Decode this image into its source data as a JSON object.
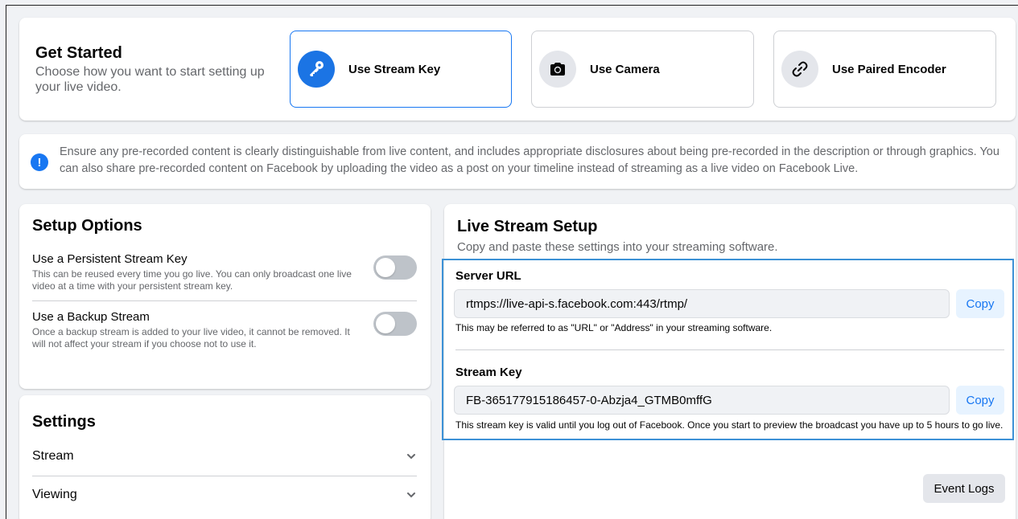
{
  "get_started": {
    "title": "Get Started",
    "subtitle": "Choose how you want to start setting up your live video.",
    "options": [
      {
        "label": "Use Stream Key",
        "icon": "key-icon",
        "selected": true
      },
      {
        "label": "Use Camera",
        "icon": "camera-icon",
        "selected": false
      },
      {
        "label": "Use Paired Encoder",
        "icon": "link-icon",
        "selected": false
      }
    ]
  },
  "notice": {
    "text": "Ensure any pre-recorded content is clearly distinguishable from live content, and includes appropriate disclosures about being pre-recorded in the description or through graphics. You can also share pre-recorded content on Facebook by uploading the video as a post on your timeline instead of streaming as a live video on Facebook Live."
  },
  "setup_options": {
    "title": "Setup Options",
    "items": [
      {
        "title": "Use a Persistent Stream Key",
        "description": "This can be reused every time you go live. You can only broadcast one live video at a time with your persistent stream key.",
        "enabled": false
      },
      {
        "title": "Use a Backup Stream",
        "description": "Once a backup stream is added to your live video, it cannot be removed. It will not affect your stream if you choose not to use it.",
        "enabled": false
      }
    ]
  },
  "settings": {
    "title": "Settings",
    "rows": [
      {
        "label": "Stream"
      },
      {
        "label": "Viewing"
      }
    ]
  },
  "live_setup": {
    "title": "Live Stream Setup",
    "subtitle": "Copy and paste these settings into your streaming software.",
    "server_url": {
      "label": "Server URL",
      "value": "rtmps://live-api-s.facebook.com:443/rtmp/",
      "copy_label": "Copy",
      "help": "This may be referred to as \"URL\" or \"Address\" in your streaming software."
    },
    "stream_key": {
      "label": "Stream Key",
      "value": "FB-365177915186457-0-Abzja4_GTMB0mffG",
      "copy_label": "Copy",
      "help": "This stream key is valid until you log out of Facebook. Once you start to preview the broadcast you have up to 5 hours to go live."
    },
    "event_logs_label": "Event Logs"
  },
  "colors": {
    "accent": "#1877f2",
    "highlight_border": "#3c91d6",
    "page_bg": "#f0f2f5"
  }
}
